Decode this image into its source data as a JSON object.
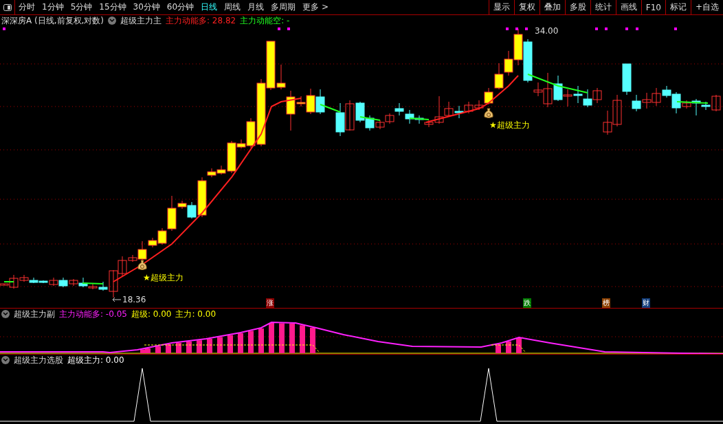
{
  "toolbar": {
    "periods": [
      {
        "label": "分时",
        "selected": false
      },
      {
        "label": "1分钟",
        "selected": false
      },
      {
        "label": "5分钟",
        "selected": false
      },
      {
        "label": "15分钟",
        "selected": false
      },
      {
        "label": "30分钟",
        "selected": false
      },
      {
        "label": "60分钟",
        "selected": false
      },
      {
        "label": "日线",
        "selected": true
      },
      {
        "label": "周线",
        "selected": false
      },
      {
        "label": "月线",
        "selected": false
      },
      {
        "label": "多周期",
        "selected": false
      },
      {
        "label": "更多 >",
        "selected": false
      }
    ],
    "actions": [
      "显示",
      "复权",
      "叠加",
      "多股",
      "统计",
      "画线",
      "F10",
      "标记",
      "+自选"
    ]
  },
  "main_chart": {
    "stock": "深深房A (日线,前复权,对数)",
    "indicator": "超级主力主",
    "legend": [
      {
        "text": "主力动能多: 28.82",
        "kind": "long"
      },
      {
        "text": "主力动能空: -",
        "kind": "short"
      }
    ],
    "high_label": "34.00",
    "low_label": "18.36",
    "signals": [
      "★超级主力",
      "★超级主力"
    ],
    "markers": [
      {
        "text": "涨",
        "color": "#8b0000"
      },
      {
        "text": "跌",
        "color": "#007a00"
      },
      {
        "text": "榜",
        "color": "#8b4000"
      },
      {
        "text": "财",
        "color": "#123d7a"
      }
    ]
  },
  "sub_panel": {
    "indicator": "超级主力副",
    "legend": [
      {
        "text": "主力动能多: -0.05",
        "color": "#ff20ff"
      },
      {
        "text": "超级: 0.00",
        "color": "#ffff00"
      },
      {
        "text": "主力: 0.00",
        "color": "#ffff00"
      }
    ]
  },
  "select_panel": {
    "indicator": "超级主力选股",
    "legend": [
      {
        "text": "超级主力: 0.00",
        "color": "#ffffff"
      }
    ]
  }
}
